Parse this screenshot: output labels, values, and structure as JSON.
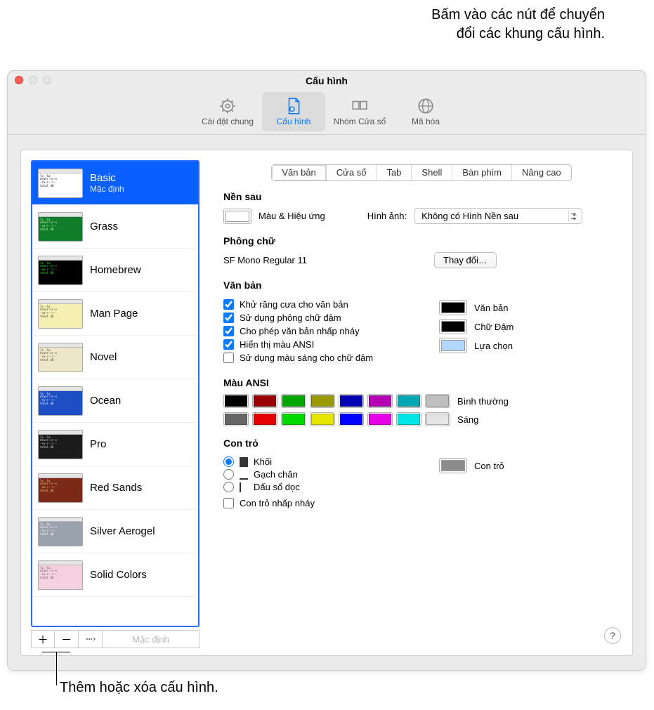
{
  "callout_top_l1": "Bấm vào các nút để chuyển",
  "callout_top_l2": "đổi các khung cấu hình.",
  "callout_bottom": "Thêm hoặc xóa cấu hình.",
  "window_title": "Cấu hình",
  "toolbar": {
    "general": "Cài đặt chung",
    "profiles": "Cấu hình",
    "groups": "Nhóm Cửa sổ",
    "encode": "Mã hóa"
  },
  "profiles": [
    {
      "name": "Basic",
      "sub": "Mặc định",
      "bg": "#ffffff",
      "fg": "#000"
    },
    {
      "name": "Grass",
      "bg": "#0f7d2a",
      "fg": "#e0ffb0"
    },
    {
      "name": "Homebrew",
      "bg": "#000000",
      "fg": "#28fe14"
    },
    {
      "name": "Man Page",
      "bg": "#f5efb3",
      "fg": "#333"
    },
    {
      "name": "Novel",
      "bg": "#ece7c8",
      "fg": "#4a3b1a"
    },
    {
      "name": "Ocean",
      "bg": "#1c4fc4",
      "fg": "#fff"
    },
    {
      "name": "Pro",
      "bg": "#1c1c1c",
      "fg": "#ddd"
    },
    {
      "name": "Red Sands",
      "bg": "#7a2a16",
      "fg": "#f0d080"
    },
    {
      "name": "Silver Aerogel",
      "bg": "#9aa3ad",
      "fg": "#fff"
    },
    {
      "name": "Solid Colors",
      "bg": "#f5d0de",
      "fg": "#555"
    }
  ],
  "footer": {
    "default": "Mặc định"
  },
  "tabs": [
    "Văn bản",
    "Cửa sổ",
    "Tab",
    "Shell",
    "Bàn phím",
    "Nâng cao"
  ],
  "bg_section": {
    "title": "Nền sau",
    "color_effects": "Màu & Hiệu ứng",
    "image_label": "Hình ảnh:",
    "image_value": "Không có Hình Nền sau"
  },
  "font_section": {
    "title": "Phông chữ",
    "value": "SF Mono Regular 11",
    "change": "Thay đổi…"
  },
  "text_section": {
    "title": "Văn bản",
    "cb1": "Khử răng cưa cho văn bản",
    "cb2": "Sử dụng phông chữ đậm",
    "cb3": "Cho phép văn bản nhấp nháy",
    "cb4": "Hiển thị màu ANSI",
    "cb5": "Sử dụng màu sáng cho chữ đậm",
    "lbl_text": "Văn bản",
    "lbl_bold": "Chữ Đậm",
    "lbl_sel": "Lựa chọn"
  },
  "ansi_section": {
    "title": "Màu ANSI",
    "normal": "Bình thường",
    "bright": "Sáng",
    "normal_colors": [
      "#000000",
      "#990000",
      "#00a600",
      "#999900",
      "#0000b2",
      "#b200b2",
      "#00a6b2",
      "#bfbfbf"
    ],
    "bright_colors": [
      "#666666",
      "#e50000",
      "#00d900",
      "#e5e500",
      "#0000ff",
      "#e500e5",
      "#00e5e5",
      "#e5e5e5"
    ]
  },
  "cursor_section": {
    "title": "Con trỏ",
    "r1": "Khối",
    "r2": "Gạch chân",
    "r3": "Dấu sổ dọc",
    "cb": "Con trỏ nhấp nháy",
    "lbl": "Con trỏ"
  }
}
